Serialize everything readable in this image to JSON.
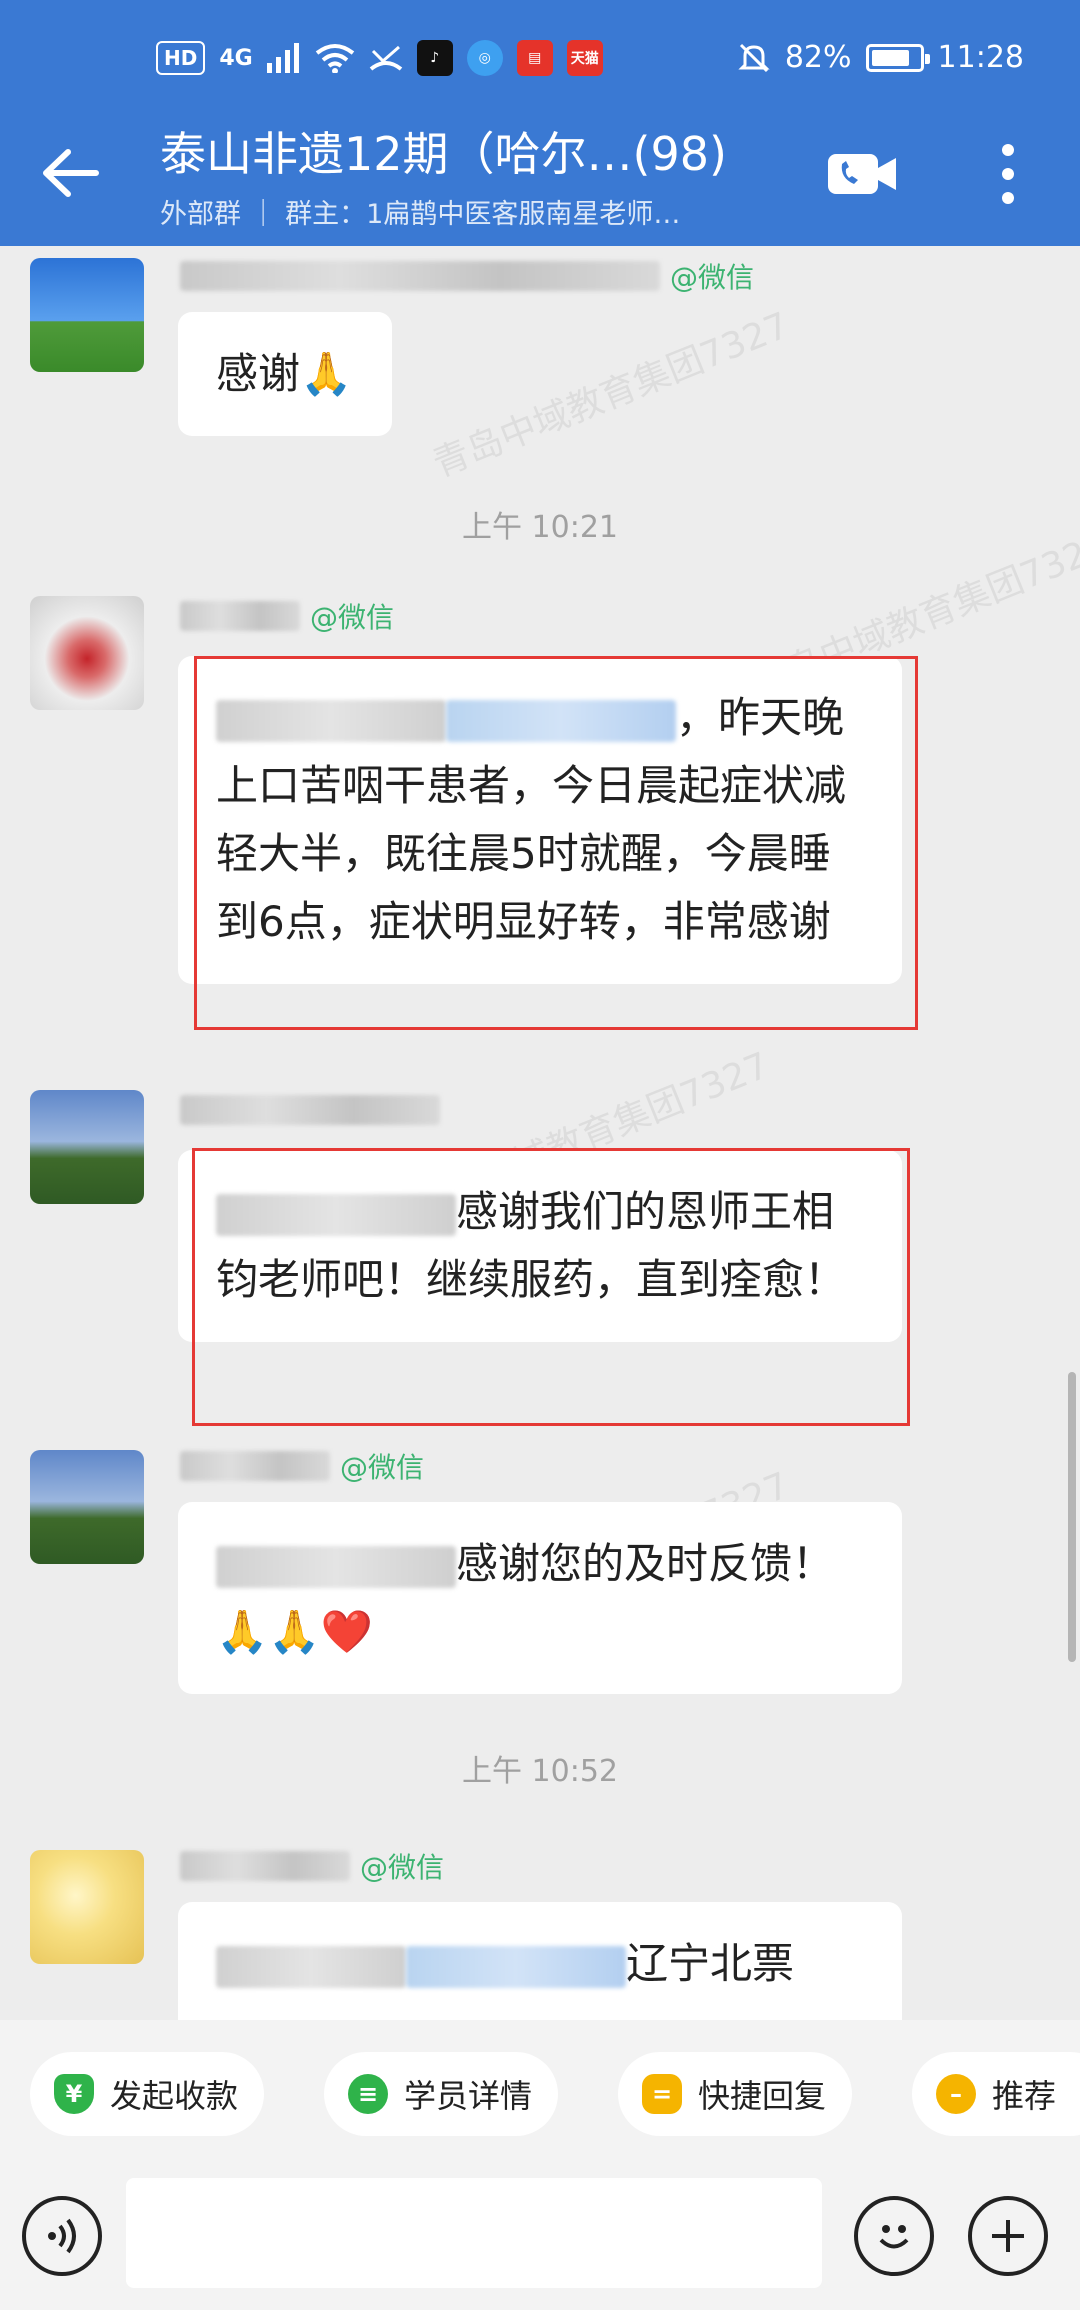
{
  "status_bar": {
    "hd": "HD",
    "network": "4G",
    "app_badge": "天猫",
    "battery": "82%",
    "battery_level": 0.82,
    "time": "11:28"
  },
  "header": {
    "title": "泰山非遗12期（哈尔…(98)",
    "subtitle": "外部群 ｜ 群主：1扁鹊中医客服南星老师…"
  },
  "messages": [
    {
      "tag": "@微信",
      "text": "感谢🙏"
    },
    {
      "tag": "@微信",
      "text": "，昨天晚上口苦咽干患者，今日晨起症状减轻大半，既往晨5时就醒，今晨睡到6点，症状明显好转，非常感谢"
    },
    {
      "tag": "@微信",
      "text": "感谢我们的恩师王相钧老师吧！继续服药，直到痊愈！"
    },
    {
      "tag": "@微信",
      "text": "感谢您的及时反馈！🙏🙏❤️"
    },
    {
      "tag": "@微信",
      "text": "辽宁北票"
    }
  ],
  "timestamps": [
    "上午 10:21",
    "上午 10:52"
  ],
  "watermark_text": "青岛中域教育集团7327",
  "quick_actions": [
    {
      "label": "发起收款",
      "icon": "yuan-icon",
      "color": "#2fb34a"
    },
    {
      "label": "学员详情",
      "icon": "student-icon",
      "color": "#2fb34a"
    },
    {
      "label": "快捷回复",
      "icon": "quick-reply-icon",
      "color": "#f5b400"
    },
    {
      "label": "推荐",
      "icon": "recommend-icon",
      "color": "#f5b400"
    }
  ],
  "input": {
    "placeholder": "",
    "value": ""
  },
  "colors": {
    "header": "#3a79d3",
    "highlight_box": "#e53935",
    "tag": "#3cb371"
  }
}
